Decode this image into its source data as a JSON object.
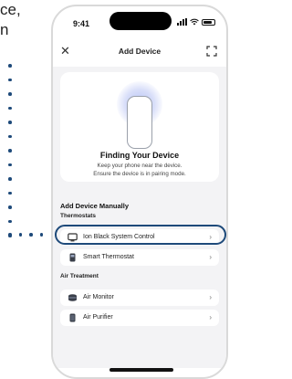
{
  "caption": {
    "line1": "ce,",
    "line2": "n"
  },
  "status_bar": {
    "time": "9:41"
  },
  "nav": {
    "title": "Add Device"
  },
  "finding": {
    "title": "Finding Your Device",
    "line1": "Keep your phone near the device.",
    "line2": "Ensure the device is in pairing mode."
  },
  "manual": {
    "title": "Add Device Manually",
    "thermostats_label": "Thermostats",
    "thermostats": [
      {
        "label": "Ion Black System Control",
        "icon": "system-control-icon"
      },
      {
        "label": "Smart Thermostat",
        "icon": "thermostat-icon",
        "highlighted": true
      }
    ],
    "air_label": "Air Treatment",
    "air": [
      {
        "label": "Air Monitor",
        "icon": "air-monitor-icon"
      },
      {
        "label": "Air Purifier",
        "icon": "air-purifier-icon"
      }
    ]
  },
  "colors": {
    "highlight": "#1e4a7a",
    "glow": "#b7c4f5",
    "background": "#f3f3f5"
  }
}
